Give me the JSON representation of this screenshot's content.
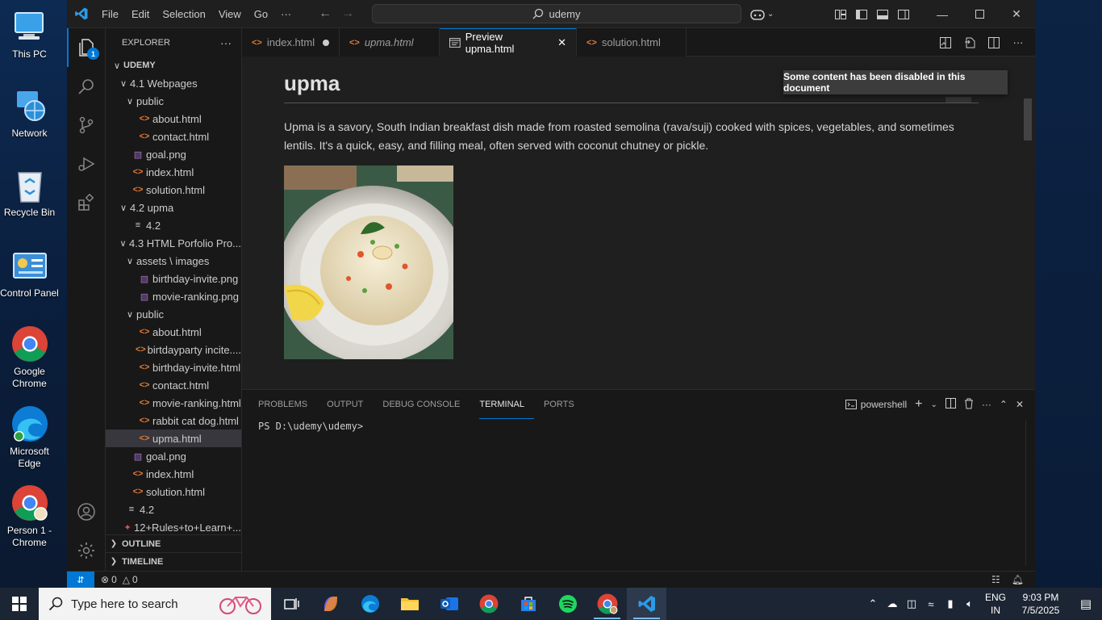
{
  "desktop": {
    "icons": [
      {
        "label": "This PC"
      },
      {
        "label": "Network"
      },
      {
        "label": "Recycle Bin"
      },
      {
        "label": "Control Panel"
      },
      {
        "label": "Google Chrome"
      },
      {
        "label": "Microsoft Edge"
      },
      {
        "label": "Person 1 - Chrome"
      }
    ]
  },
  "titlebar": {
    "menus": [
      "File",
      "Edit",
      "Selection",
      "View",
      "Go"
    ],
    "more": "···",
    "search_text": "udemy"
  },
  "activitybar": {
    "explorer_badge": "1"
  },
  "sidebar": {
    "header": "EXPLORER",
    "more": "···",
    "tree": [
      {
        "indent": 0,
        "kind": "folder-open",
        "label": "UDEMY",
        "bold": true
      },
      {
        "indent": 1,
        "kind": "folder-open",
        "label": "4.1 Webpages"
      },
      {
        "indent": 2,
        "kind": "folder-open",
        "label": "public"
      },
      {
        "indent": 3,
        "kind": "html",
        "label": "about.html"
      },
      {
        "indent": 3,
        "kind": "html",
        "label": "contact.html"
      },
      {
        "indent": 2,
        "kind": "img",
        "label": "goal.png"
      },
      {
        "indent": 2,
        "kind": "html",
        "label": "index.html"
      },
      {
        "indent": 2,
        "kind": "html",
        "label": "solution.html"
      },
      {
        "indent": 1,
        "kind": "folder-open",
        "label": "4.2 upma"
      },
      {
        "indent": 2,
        "kind": "txt",
        "label": "4.2"
      },
      {
        "indent": 1,
        "kind": "folder-open",
        "label": "4.3 HTML Porfolio Pro..."
      },
      {
        "indent": 2,
        "kind": "folder-open",
        "label": "assets \\ images"
      },
      {
        "indent": 3,
        "kind": "img",
        "label": "birthday-invite.png"
      },
      {
        "indent": 3,
        "kind": "img",
        "label": "movie-ranking.png"
      },
      {
        "indent": 2,
        "kind": "folder-open",
        "label": "public"
      },
      {
        "indent": 3,
        "kind": "html",
        "label": "about.html"
      },
      {
        "indent": 3,
        "kind": "html",
        "label": "birtdayparty incite...."
      },
      {
        "indent": 3,
        "kind": "html",
        "label": "birthday-invite.html"
      },
      {
        "indent": 3,
        "kind": "html",
        "label": "contact.html"
      },
      {
        "indent": 3,
        "kind": "html",
        "label": "movie-ranking.html"
      },
      {
        "indent": 3,
        "kind": "html",
        "label": "rabbit cat dog.html"
      },
      {
        "indent": 3,
        "kind": "html",
        "label": "upma.html",
        "selected": true
      },
      {
        "indent": 2,
        "kind": "img",
        "label": "goal.png"
      },
      {
        "indent": 2,
        "kind": "html",
        "label": "index.html"
      },
      {
        "indent": 2,
        "kind": "html",
        "label": "solution.html"
      },
      {
        "indent": 1,
        "kind": "txt",
        "label": "4.2"
      },
      {
        "indent": 1,
        "kind": "pdf",
        "label": "12+Rules+to+Learn+..."
      }
    ],
    "outline": "OUTLINE",
    "timeline": "TIMELINE"
  },
  "tabs": [
    {
      "label": "index.html",
      "modified": true
    },
    {
      "label": "upma.html",
      "italic": true
    },
    {
      "label": "Preview upma.html",
      "active": true
    },
    {
      "label": "solution.html"
    }
  ],
  "preview": {
    "title": "upma",
    "paragraph": "Upma is a savory, South Indian breakfast dish made from roasted semolina (rava/suji) cooked with spices, vegetables, and sometimes lentils. It's a quick, easy, and filling meal, often served with coconut chutney or pickle.",
    "notice": "Some content has been disabled in this document"
  },
  "panel": {
    "tabs": [
      "PROBLEMS",
      "OUTPUT",
      "DEBUG CONSOLE",
      "TERMINAL",
      "PORTS"
    ],
    "active_tab": "TERMINAL",
    "shell": "powershell",
    "prompt": "PS D:\\udemy\\udemy>"
  },
  "statusbar": {
    "errors": "0",
    "warnings": "0"
  },
  "taskbar": {
    "search_placeholder": "Type here to search",
    "language": "ENG",
    "region": "IN",
    "time": "9:03 PM",
    "date": "7/5/2025"
  },
  "colors": {
    "accent": "#0078d4",
    "html_icon": "#e37933",
    "image_icon": "#a074c4"
  }
}
